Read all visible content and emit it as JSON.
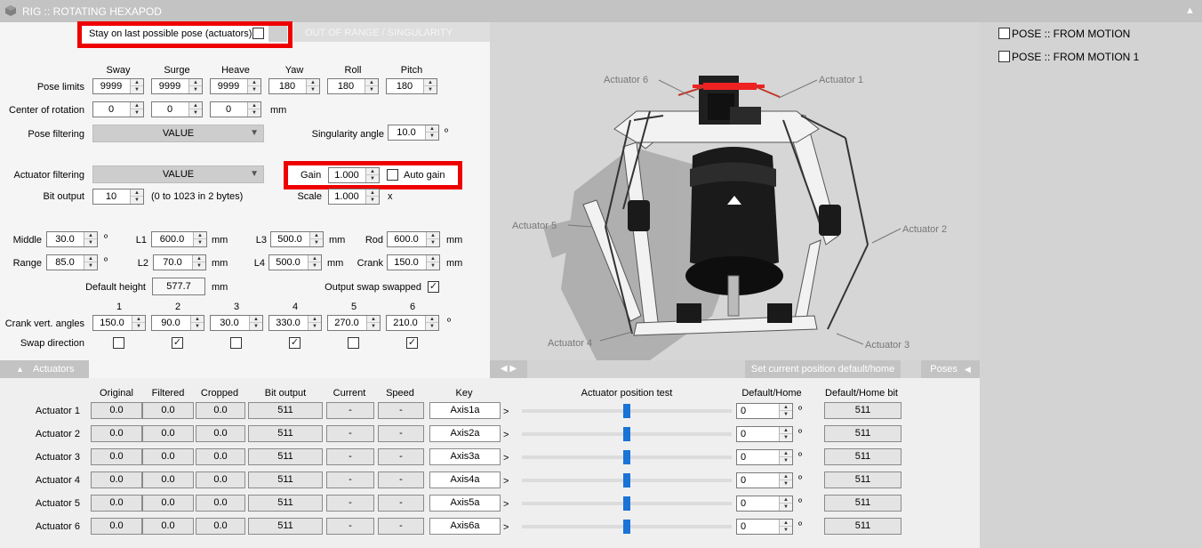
{
  "app": {
    "title": "RIG :: ROTATING HEXAPOD",
    "collapse_icon": "triangle-up-icon"
  },
  "stay_pose": {
    "label": "Stay on last possible pose (actuators)",
    "checked": false
  },
  "warning": {
    "label": "OUT OF RANGE / SINGULARITY"
  },
  "pose_limits": {
    "headers": [
      "Sway",
      "Surge",
      "Heave",
      "Yaw",
      "Roll",
      "Pitch"
    ],
    "label": "Pose limits",
    "values": [
      "9999",
      "9999",
      "9999",
      "180",
      "180",
      "180"
    ]
  },
  "center_rotation": {
    "label": "Center of rotation",
    "values": [
      "0",
      "0",
      "0"
    ],
    "unit": "mm"
  },
  "pose_filtering": {
    "label": "Pose filtering",
    "value": "VALUE"
  },
  "singularity": {
    "label": "Singularity angle",
    "value": "10.0",
    "unit": "º"
  },
  "actuator_filtering": {
    "label": "Actuator filtering",
    "value": "VALUE"
  },
  "gain": {
    "label": "Gain",
    "value": "1.000",
    "auto_label": "Auto gain",
    "auto_checked": false
  },
  "bit_output": {
    "label": "Bit output",
    "value": "10",
    "note": "(0 to 1023 in 2 bytes)"
  },
  "scale": {
    "label": "Scale",
    "value": "1.000",
    "unit": "x"
  },
  "geometry": {
    "middle": {
      "label": "Middle",
      "value": "30.0",
      "unit": "º"
    },
    "range": {
      "label": "Range",
      "value": "85.0",
      "unit": "º"
    },
    "l1": {
      "label": "L1",
      "value": "600.0",
      "unit": "mm"
    },
    "l2": {
      "label": "L2",
      "value": "70.0",
      "unit": "mm"
    },
    "l3": {
      "label": "L3",
      "value": "500.0",
      "unit": "mm"
    },
    "l4": {
      "label": "L4",
      "value": "500.0",
      "unit": "mm"
    },
    "rod": {
      "label": "Rod",
      "value": "600.0",
      "unit": "mm"
    },
    "crank": {
      "label": "Crank",
      "value": "150.0",
      "unit": "mm"
    }
  },
  "default_height": {
    "label": "Default height",
    "value": "577.7",
    "unit": "mm"
  },
  "output_swap": {
    "label": "Output swap swapped",
    "checked": true
  },
  "crank_angles": {
    "label": "Crank vert. angles",
    "headers": [
      "1",
      "2",
      "3",
      "4",
      "5",
      "6"
    ],
    "values": [
      "150.0",
      "90.0",
      "30.0",
      "330.0",
      "270.0",
      "210.0"
    ],
    "unit": "º"
  },
  "swap_direction": {
    "label": "Swap direction",
    "checked": [
      false,
      true,
      false,
      true,
      false,
      true
    ]
  },
  "illustration": {
    "labels": [
      "Actuator 6",
      "Actuator 1",
      "Actuator 5",
      "Actuator 2",
      "Actuator 4",
      "Actuator 3"
    ]
  },
  "tabs": {
    "actuators": "Actuators",
    "arrows_icon": "left-right-arrows-icon",
    "set_default": "Set current position default/home",
    "poses": "Poses"
  },
  "actuator_table": {
    "headers": [
      "Original",
      "Filtered",
      "Cropped",
      "Bit output",
      "Current",
      "Speed",
      "Key",
      "Actuator position test",
      "Default/Home",
      "Default/Home bit"
    ],
    "rows": [
      {
        "name": "Actuator 1",
        "original": "0.0",
        "filtered": "0.0",
        "cropped": "0.0",
        "bit": "511",
        "current": "-",
        "speed": "-",
        "key": "Axis1a",
        "arrow": ">",
        "position": 0.5,
        "home": "0",
        "unit": "º",
        "home_bit": "511"
      },
      {
        "name": "Actuator 2",
        "original": "0.0",
        "filtered": "0.0",
        "cropped": "0.0",
        "bit": "511",
        "current": "-",
        "speed": "-",
        "key": "Axis2a",
        "arrow": ">",
        "position": 0.5,
        "home": "0",
        "unit": "º",
        "home_bit": "511"
      },
      {
        "name": "Actuator 3",
        "original": "0.0",
        "filtered": "0.0",
        "cropped": "0.0",
        "bit": "511",
        "current": "-",
        "speed": "-",
        "key": "Axis3a",
        "arrow": ">",
        "position": 0.5,
        "home": "0",
        "unit": "º",
        "home_bit": "511"
      },
      {
        "name": "Actuator 4",
        "original": "0.0",
        "filtered": "0.0",
        "cropped": "0.0",
        "bit": "511",
        "current": "-",
        "speed": "-",
        "key": "Axis4a",
        "arrow": ">",
        "position": 0.5,
        "home": "0",
        "unit": "º",
        "home_bit": "511"
      },
      {
        "name": "Actuator 5",
        "original": "0.0",
        "filtered": "0.0",
        "cropped": "0.0",
        "bit": "511",
        "current": "-",
        "speed": "-",
        "key": "Axis5a",
        "arrow": ">",
        "position": 0.5,
        "home": "0",
        "unit": "º",
        "home_bit": "511"
      },
      {
        "name": "Actuator 6",
        "original": "0.0",
        "filtered": "0.0",
        "cropped": "0.0",
        "bit": "511",
        "current": "-",
        "speed": "-",
        "key": "Axis6a",
        "arrow": ">",
        "position": 0.5,
        "home": "0",
        "unit": "º",
        "home_bit": "511"
      }
    ]
  },
  "poses": [
    {
      "label": "POSE :: FROM MOTION",
      "checked": false
    },
    {
      "label": "POSE :: FROM MOTION 1",
      "checked": false
    }
  ],
  "colors": {
    "title_bar": "#c3c3c3",
    "panel": "#f5f5f5",
    "viewport": "#d6d6d6",
    "highlight": "#ee0000",
    "slider": "#1a73d6"
  }
}
